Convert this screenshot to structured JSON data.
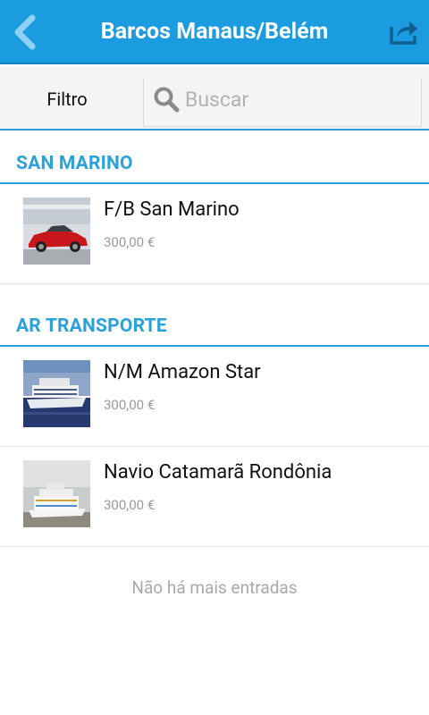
{
  "app": {
    "title": "Barcos Manaus/Belém"
  },
  "toolbar": {
    "back_icon": "back-chevron-icon",
    "share_icon": "share-icon",
    "accent": "#1b9be0"
  },
  "filter": {
    "label": "Filtro",
    "search_placeholder": "Buscar",
    "search_value": ""
  },
  "sections": [
    {
      "header": "SAN MARINO",
      "items": [
        {
          "title": "F/B San Marino",
          "price": "300,00 €",
          "thumb": "red-car-photo"
        }
      ]
    },
    {
      "header": "AR TRANSPORTE",
      "items": [
        {
          "title": "N/M Amazon Star",
          "price": "300,00 €",
          "thumb": "river-boat-photo"
        },
        {
          "title": "Navio Catamarã Rondônia",
          "price": "300,00 €",
          "thumb": "catamaran-photo"
        }
      ]
    }
  ],
  "footer": {
    "no_more": "Não há mais entradas"
  }
}
